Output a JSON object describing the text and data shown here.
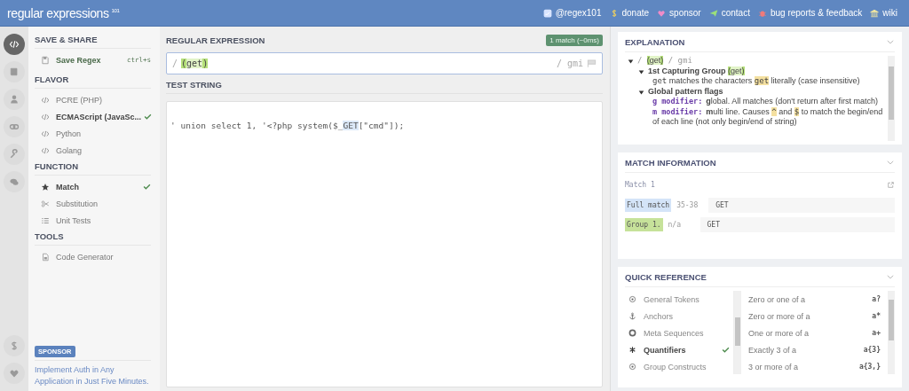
{
  "header": {
    "logo": "regular expressions",
    "logo_sup": "101",
    "links": [
      {
        "label": "@regex101"
      },
      {
        "label": "donate"
      },
      {
        "label": "sponsor"
      },
      {
        "label": "contact"
      },
      {
        "label": "bug reports & feedback"
      },
      {
        "label": "wiki"
      }
    ]
  },
  "rail": [
    {
      "selected": true
    },
    {
      "selected": false
    },
    {
      "selected": false
    },
    {
      "selected": false
    },
    {
      "selected": false
    },
    {
      "selected": false
    }
  ],
  "sidebar": {
    "save_share": {
      "title": "SAVE & SHARE",
      "label": "Save Regex",
      "shortcut": "ctrl+s"
    },
    "flavor": {
      "title": "FLAVOR",
      "items": [
        {
          "label": "PCRE (PHP)",
          "selected": false
        },
        {
          "label": "ECMAScript (JavaSc...",
          "selected": true
        },
        {
          "label": "Python",
          "selected": false
        },
        {
          "label": "Golang",
          "selected": false
        }
      ]
    },
    "function": {
      "title": "FUNCTION",
      "items": [
        {
          "label": "Match",
          "selected": true
        },
        {
          "label": "Substitution",
          "selected": false
        },
        {
          "label": "Unit Tests",
          "selected": false
        }
      ]
    },
    "tools": {
      "title": "TOOLS",
      "items": [
        {
          "label": "Code Generator"
        }
      ]
    },
    "sponsor": {
      "badge": "SPONSOR",
      "text": "Implement Auth in Any Application in Just Five Minutes."
    }
  },
  "regex": {
    "title": "REGULAR EXPRESSION",
    "match_badge": "1 match (~0ms)",
    "open": "/",
    "parts": [
      {
        "text": "(",
        "kind": "paren"
      },
      {
        "text": "get",
        "kind": "groupbody"
      },
      {
        "text": ")",
        "kind": "paren"
      }
    ],
    "flags": "/ gmi"
  },
  "test": {
    "title": "TEST STRING",
    "parts": [
      {
        "text": "' union select 1, '<?php system($_",
        "kind": "plain"
      },
      {
        "text": "GET",
        "kind": "match"
      },
      {
        "text": "[\"cmd\"]);",
        "kind": "plain"
      }
    ]
  },
  "explanation": {
    "title": "EXPLANATION",
    "items": [
      {
        "expanded": true,
        "parts": [
          {
            "text": "/ ",
            "kind": "delim"
          },
          {
            "text": "(",
            "kind": "paren"
          },
          {
            "text": "get",
            "kind": "groupbody"
          },
          {
            "text": ")",
            "kind": "paren"
          },
          {
            "text": " / gmi",
            "kind": "delim"
          }
        ],
        "children": [
          {
            "expanded": true,
            "parts": [
              {
                "text": "1st Capturing Group ",
                "kind": "bold"
              },
              {
                "text": "(",
                "kind": "paren"
              },
              {
                "text": "get",
                "kind": "groupbody"
              },
              {
                "text": ")",
                "kind": "paren"
              }
            ],
            "children": [
              {
                "parts": [
                  {
                    "text": "get",
                    "kind": "mono"
                  },
                  {
                    "text": " matches the characters ",
                    "kind": "plain"
                  },
                  {
                    "text": "get",
                    "kind": "hl"
                  },
                  {
                    "text": " literally (case insensitive)",
                    "kind": "plain"
                  }
                ]
              }
            ]
          },
          {
            "expanded": true,
            "parts": [
              {
                "text": "Global pattern flags",
                "kind": "bold"
              }
            ],
            "children": [
              {
                "parts": [
                  {
                    "text": "g modifier:",
                    "kind": "flag"
                  },
                  {
                    "text": "g",
                    "kind": "bold"
                  },
                  {
                    "text": "lobal. All matches (don't return after first match)",
                    "kind": "plain"
                  }
                ]
              },
              {
                "parts": [
                  {
                    "text": "m modifier:",
                    "kind": "flag"
                  },
                  {
                    "text": "m",
                    "kind": "bold"
                  },
                  {
                    "text": "ulti line. Causes ",
                    "kind": "plain"
                  },
                  {
                    "text": "^",
                    "kind": "hl"
                  },
                  {
                    "text": " and ",
                    "kind": "plain"
                  },
                  {
                    "text": "$",
                    "kind": "hl"
                  },
                  {
                    "text": " to match the begin/end of each line (not only begin/end of string)",
                    "kind": "plain"
                  }
                ]
              }
            ]
          }
        ]
      }
    ]
  },
  "match_info": {
    "title": "MATCH INFORMATION",
    "match_label": "Match 1",
    "rows": [
      {
        "kind": "full",
        "label": "Full match",
        "range": "35-38",
        "value": "GET"
      },
      {
        "kind": "group",
        "label": "Group 1.",
        "range": "n/a",
        "value": "GET"
      }
    ]
  },
  "quick_reference": {
    "title": "QUICK REFERENCE",
    "categories": [
      {
        "label": "General Tokens",
        "selected": false
      },
      {
        "label": "Anchors",
        "selected": false
      },
      {
        "label": "Meta Sequences",
        "selected": false
      },
      {
        "label": "Quantifiers",
        "selected": true
      },
      {
        "label": "Group Constructs",
        "selected": false
      }
    ],
    "tokens": [
      {
        "description": "Zero or one of a",
        "token": "a?"
      },
      {
        "description": "Zero or more of a",
        "token": "a*"
      },
      {
        "description": "One or more of a",
        "token": "a+"
      },
      {
        "description": "Exactly 3 of a",
        "token": "a{3}"
      },
      {
        "description": "3 or more of a",
        "token": "a{3,}"
      }
    ]
  }
}
